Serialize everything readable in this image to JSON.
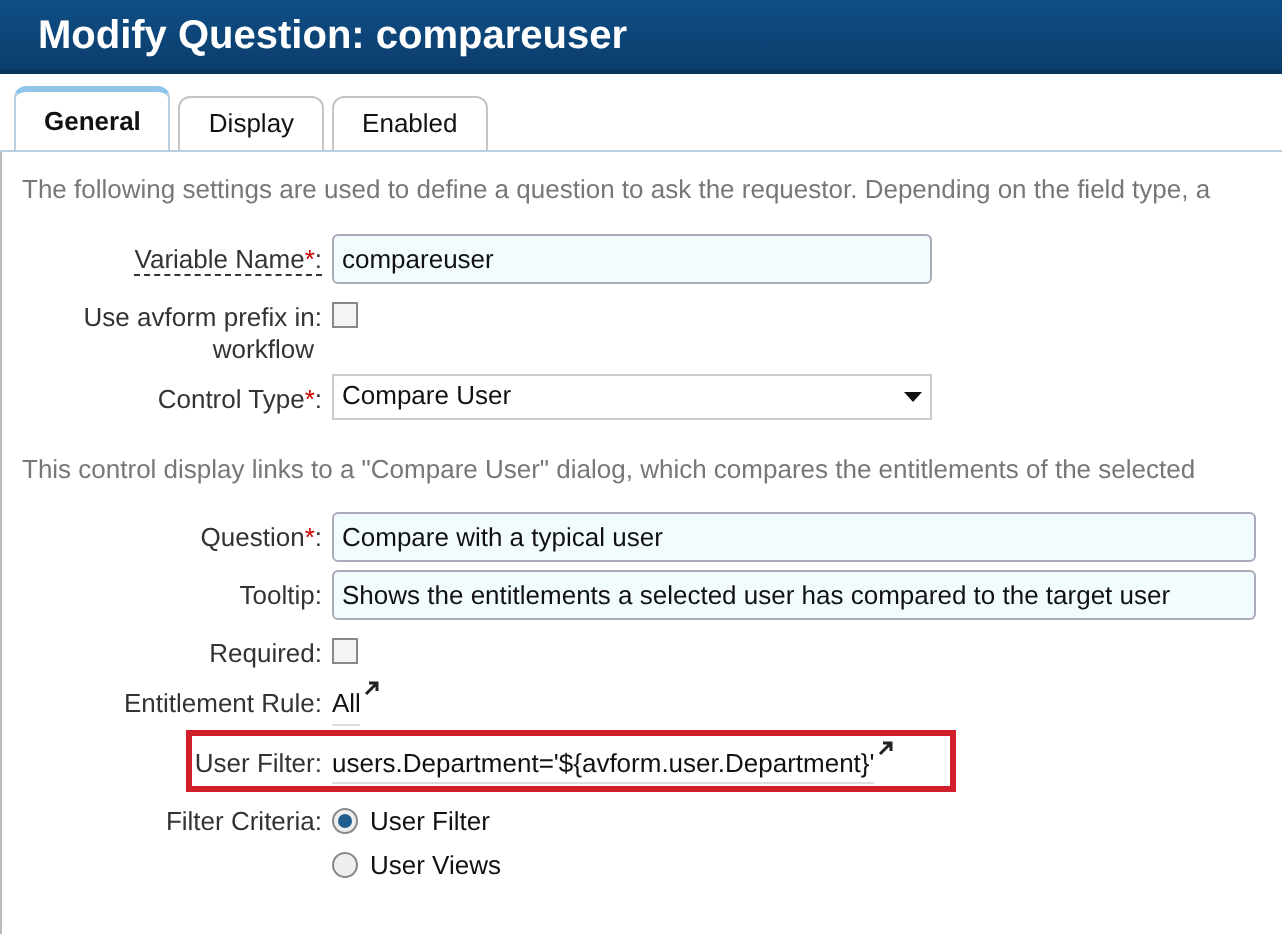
{
  "window": {
    "title": "Modify Question: compareuser"
  },
  "tabs": [
    {
      "label": "General",
      "selected": true
    },
    {
      "label": "Display",
      "selected": false
    },
    {
      "label": "Enabled",
      "selected": false
    }
  ],
  "sections": [
    {
      "intro": "The following settings are used to define a question to ask the requestor. Depending on the field type, a",
      "fields": [
        {
          "kind": "text",
          "label": "Variable Name",
          "marker": "*",
          "colon": ":",
          "help": true,
          "value": "compareuser",
          "wide": false
        },
        {
          "kind": "checkbox",
          "label": "Use avform prefix in",
          "colon": ":",
          "label_line_2": "workflow",
          "help": false,
          "checked": false
        },
        {
          "kind": "select",
          "label": "Control Type",
          "marker": "*",
          "colon": ":",
          "help": false,
          "value": "Compare User"
        }
      ]
    },
    {
      "intro": "This control display links to a \"Compare User\" dialog, which compares the entitlements of the selected",
      "fields": [
        {
          "kind": "text",
          "label": "Question",
          "marker": "*",
          "colon": ":",
          "help": false,
          "value": "Compare with a typical user",
          "wide": true
        },
        {
          "kind": "text",
          "label": "Tooltip",
          "colon": ":",
          "help": false,
          "value": "Shows the entitlements a selected user has compared to the target user",
          "wide": true
        },
        {
          "kind": "checkbox",
          "label": "Required",
          "colon": ":",
          "help": false,
          "checked": false
        },
        {
          "kind": "link",
          "label": "Entitlement Rule",
          "colon": ":",
          "help": false,
          "value": "All",
          "highlighted": false
        },
        {
          "kind": "link",
          "label": "User Filter",
          "colon": ":",
          "help": false,
          "value": "users.Department='${avform.user.Department}'",
          "highlighted": true
        },
        {
          "kind": "radio",
          "label": "Filter Criteria",
          "colon": ":",
          "help": false,
          "options": [
            {
              "label": "User Filter",
              "selected": true
            },
            {
              "label": "User Views",
              "selected": false
            }
          ]
        }
      ]
    }
  ]
}
